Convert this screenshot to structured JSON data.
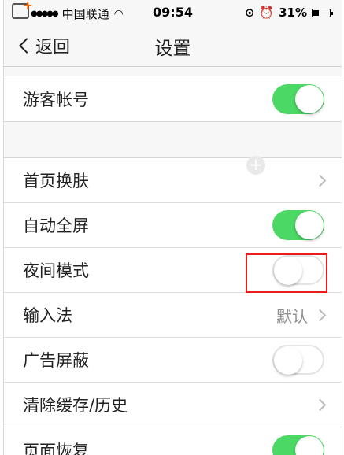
{
  "status_bar": {
    "carrier": "中国联通",
    "time": "09:54",
    "battery": "31%"
  },
  "nav": {
    "back_label": "返回",
    "title": "设置"
  },
  "section1": {
    "items": [
      {
        "label": "游客帐号",
        "control": "toggle",
        "state": "on"
      }
    ]
  },
  "section2": {
    "items": [
      {
        "label": "首页换肤",
        "control": "chevron"
      },
      {
        "label": "自动全屏",
        "control": "toggle",
        "state": "on"
      },
      {
        "label": "夜间模式",
        "control": "toggle",
        "state": "off"
      },
      {
        "label": "输入法",
        "control": "chevron",
        "value": "默认"
      },
      {
        "label": "广告屏蔽",
        "control": "toggle",
        "state": "off"
      },
      {
        "label": "清除缓存/历史",
        "control": "chevron"
      },
      {
        "label": "页面恢复",
        "control": "toggle",
        "state": "on"
      }
    ]
  },
  "colors": {
    "toggle_on": "#4cd864",
    "highlight": "#e81e1e"
  }
}
